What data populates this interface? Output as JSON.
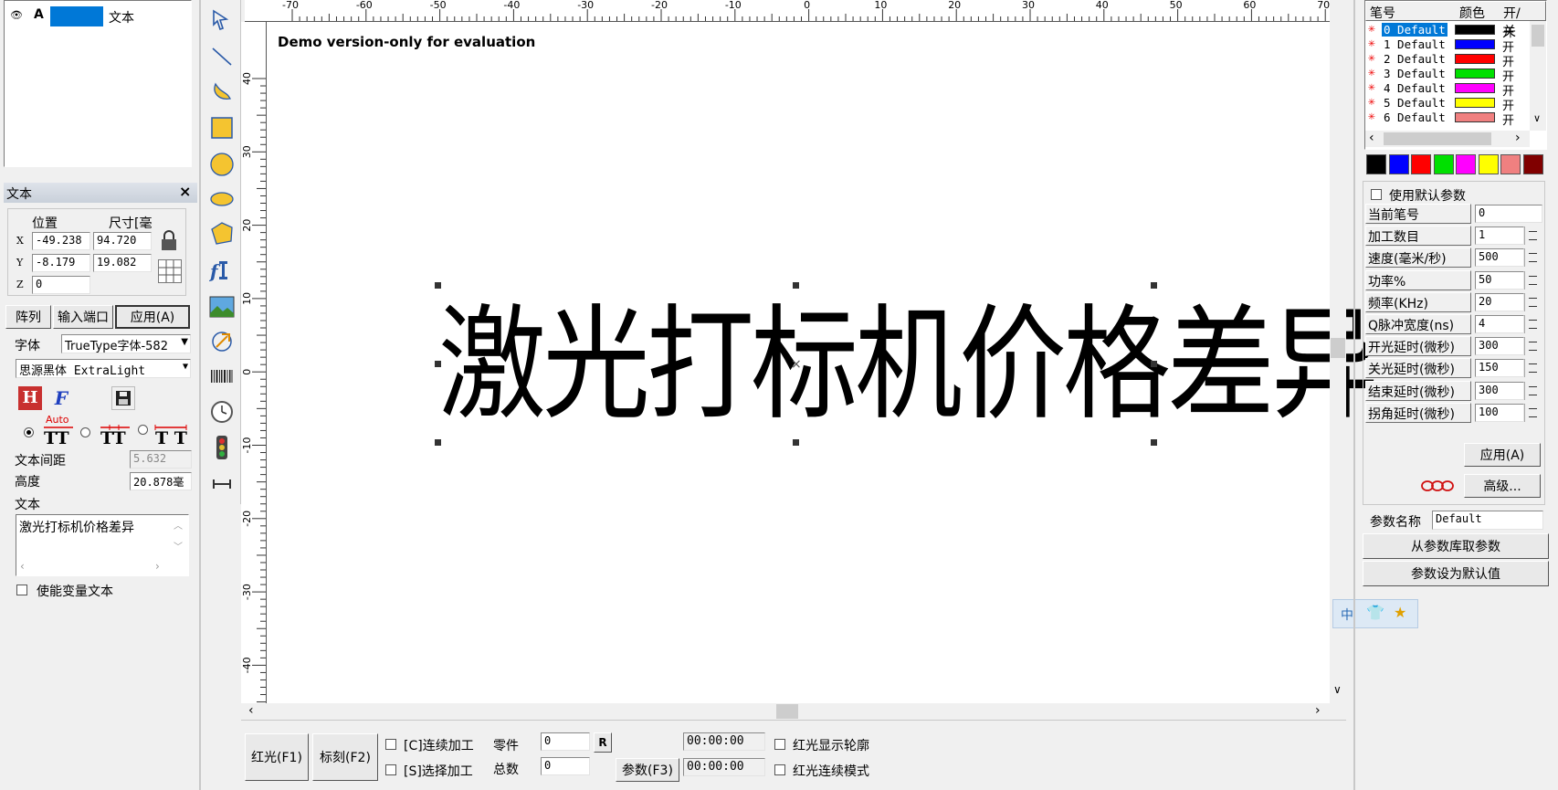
{
  "objectList": {
    "row": {
      "icon": "eye-icon",
      "type": "A",
      "name": "文本"
    }
  },
  "propPanel": {
    "title": "文本",
    "close": "×",
    "posHeader": "位置",
    "sizeHeader": "尺寸[毫",
    "x": {
      "label": "X",
      "pos": "-49.238",
      "size": "94.720"
    },
    "y": {
      "label": "Y",
      "pos": "-8.179",
      "size": "19.082"
    },
    "z": {
      "label": "Z",
      "pos": "0"
    },
    "buttons": {
      "array": "阵列",
      "inputPort": "输入端口",
      "apply": "应用(A)"
    },
    "fontLabel": "字体",
    "fontType": "TrueType字体-582",
    "fontName": "思源黑体 ExtraLight",
    "autoLabel": "Auto",
    "spacingLabel": "文本间距",
    "spacingValue": "5.632",
    "heightLabel": "高度",
    "heightValue": "20.878毫",
    "textLabel": "文本",
    "textValue": "激光打标机价格差异",
    "variableText": "使能变量文本"
  },
  "canvas": {
    "demo": "Demo version-only for evaluation",
    "text": "激光打标机价格差异",
    "hruler": [
      "-70",
      "-60",
      "-50",
      "-40",
      "-30",
      "-20",
      "-10",
      "0",
      "10",
      "20",
      "30",
      "40",
      "50",
      "60",
      "70"
    ],
    "vruler": [
      "40",
      "30",
      "20",
      "10",
      "0",
      "-10",
      "-20",
      "-30",
      "-40"
    ]
  },
  "penPanel": {
    "headers": {
      "pen": "笔号",
      "color": "颜色",
      "onoff": "开/关"
    },
    "pens": [
      {
        "name": "0 Default",
        "color": "#000000",
        "state": "开"
      },
      {
        "name": "1 Default",
        "color": "#0000ff",
        "state": "开"
      },
      {
        "name": "2 Default",
        "color": "#ff0000",
        "state": "开"
      },
      {
        "name": "3 Default",
        "color": "#00e000",
        "state": "开"
      },
      {
        "name": "4 Default",
        "color": "#ff00ff",
        "state": "开"
      },
      {
        "name": "5 Default",
        "color": "#ffff00",
        "state": "开"
      },
      {
        "name": "6 Default",
        "color": "#f08080",
        "state": "开"
      }
    ],
    "palette": [
      "#000000",
      "#0000ff",
      "#ff0000",
      "#00e000",
      "#ff00ff",
      "#ffff00",
      "#f08080",
      "#800000"
    ],
    "useDefault": "使用默认参数",
    "params": [
      {
        "label": "当前笔号",
        "value": "0",
        "spin": false
      },
      {
        "label": "加工数目",
        "value": "1",
        "spin": true
      },
      {
        "label": "速度(毫米/秒)",
        "value": "500",
        "spin": true
      },
      {
        "label": "功率%",
        "value": "50",
        "spin": true
      },
      {
        "label": "频率(KHz)",
        "value": "20",
        "spin": true
      },
      {
        "label": "Q脉冲宽度(ns)",
        "value": "4",
        "spin": true
      },
      {
        "label": "开光延时(微秒)",
        "value": "300",
        "spin": true
      },
      {
        "label": "关光延时(微秒)",
        "value": "150",
        "spin": true
      },
      {
        "label": "结束延时(微秒)",
        "value": "300",
        "spin": true
      },
      {
        "label": "拐角延时(微秒)",
        "value": "100",
        "spin": true
      }
    ],
    "apply": "应用(A)",
    "advanced": "高级...",
    "paramNameLabel": "参数名称",
    "paramNameValue": "Default",
    "fromLibrary": "从参数库取参数",
    "setDefault": "参数设为默认值"
  },
  "ime": {
    "lang": "中"
  },
  "bottomBar": {
    "redLight": "红光(F1)",
    "mark": "标刻(F2)",
    "continuous": "[C]连续加工",
    "selected": "[S]选择加工",
    "partsLabel": "零件",
    "partsValue": "0",
    "totalLabel": "总数",
    "totalValue": "0",
    "resetBtn": "R",
    "paramsBtn": "参数(F3)",
    "time1": "00:00:00",
    "time2": "00:00:00",
    "showContour": "红光显示轮廓",
    "continuousMode": "红光连续模式"
  }
}
